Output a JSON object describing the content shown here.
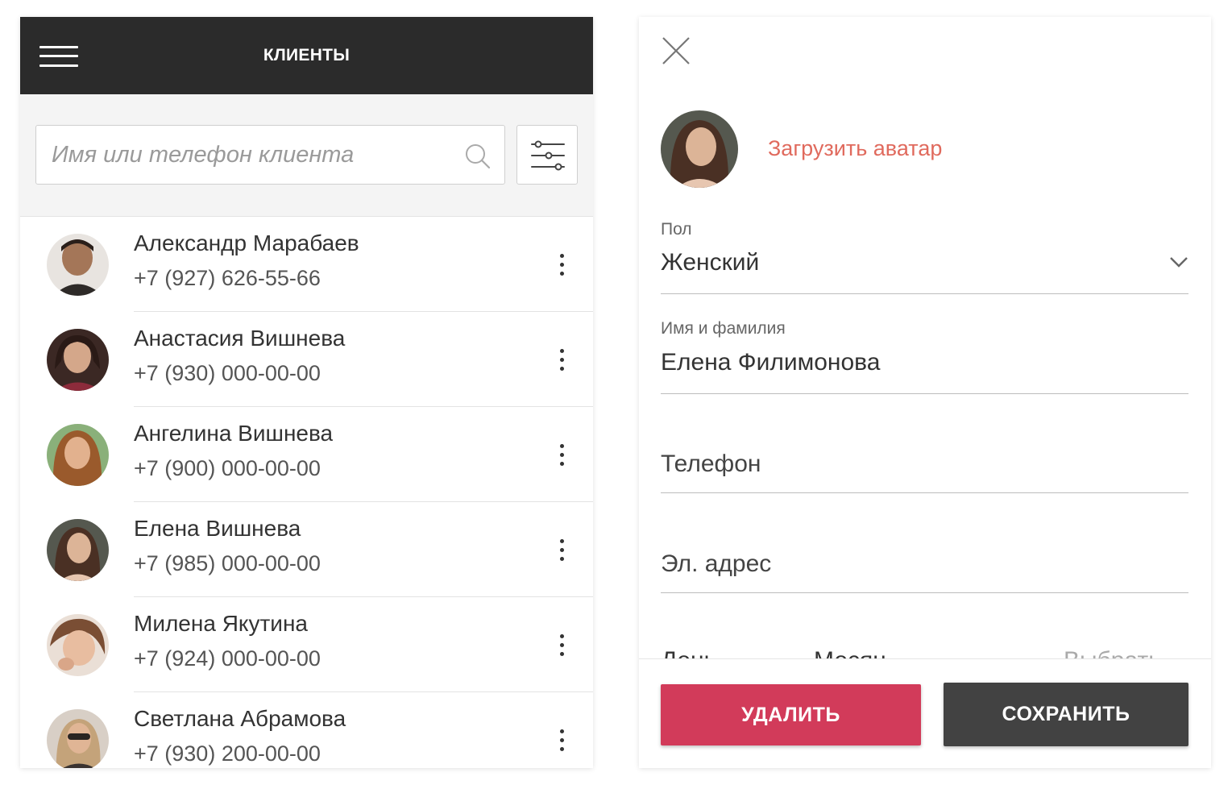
{
  "clients_screen": {
    "title": "КЛИЕНТЫ",
    "menu_icon": "hamburger-menu-icon",
    "search": {
      "placeholder": "Имя или телефон клиента",
      "value": "",
      "icon": "search-icon"
    },
    "filter_icon": "filter-sliders-icon",
    "clients": [
      {
        "name": "Александр Марабаев",
        "phone": "+7 (927) 626-55-66",
        "avatar_color": "#8a6a55"
      },
      {
        "name": "Анастасия Вишнева",
        "phone": "+7 (930) 000-00-00",
        "avatar_color": "#5a3a35"
      },
      {
        "name": "Ангелина Вишнева",
        "phone": "+7 (900) 000-00-00",
        "avatar_color": "#b0784a"
      },
      {
        "name": "Елена Вишнева",
        "phone": "+7 (985) 000-00-00",
        "avatar_color": "#6d5a4e"
      },
      {
        "name": "Милена Якутина",
        "phone": "+7 (924) 000-00-00",
        "avatar_color": "#c89a7e"
      },
      {
        "name": "Светлана Абрамова",
        "phone": "+7 (930) 200-00-00",
        "avatar_color": "#7e6552"
      }
    ]
  },
  "edit_screen": {
    "close_icon": "close-icon",
    "upload_avatar_label": "Загрузить аватар",
    "gender": {
      "label": "Пол",
      "value": "Женский"
    },
    "full_name": {
      "label": "Имя и фамилия",
      "value": "Елена Филимонова"
    },
    "phone": {
      "placeholder": "Телефон"
    },
    "email": {
      "placeholder": "Эл. адрес"
    },
    "buttons": {
      "delete_label": "УДАЛИТЬ",
      "save_label": "СОХРАНИТЬ"
    }
  },
  "colors": {
    "topbar": "#2b2b2b",
    "accent_link": "#e06a5d",
    "delete_button": "#d23b5a",
    "save_button": "#424242"
  }
}
